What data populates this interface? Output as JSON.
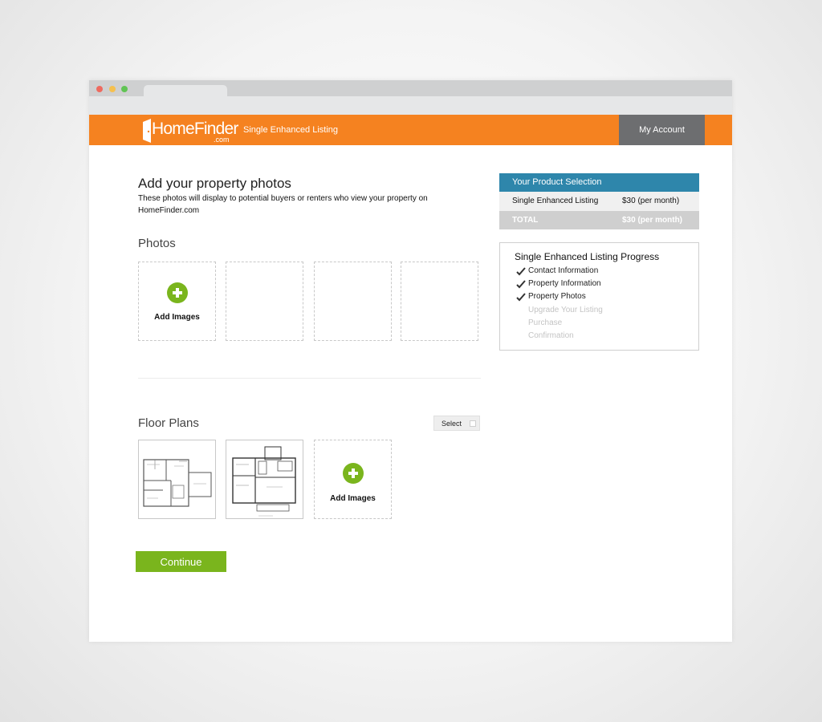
{
  "colors": {
    "brand_orange": "#f58220",
    "account_gray": "#6d6e70",
    "summary_blue": "#2e86ab",
    "accent_green": "#7ab51d",
    "dot_red": "#ee6a5f",
    "dot_yellow": "#f5c04f",
    "dot_green": "#61c454"
  },
  "header": {
    "logo_text": "HomeFinder",
    "logo_suffix": ".com",
    "subtitle": "Single Enhanced Listing",
    "account_label": "My Account",
    "logo_icon": "door-icon"
  },
  "main": {
    "title": "Add your property photos",
    "description": "These photos will display to potential buyers or renters who view your property on HomeFinder.com",
    "photos_heading": "Photos",
    "add_images_label": "Add Images",
    "floor_plans_heading": "Floor Plans",
    "select_label": "Select",
    "floor_plan_add_label": "Add Images",
    "continue_label": "Continue",
    "add_icon": "plus-circle-icon"
  },
  "summary": {
    "heading": "Your Product Selection",
    "item_name": "Single Enhanced Listing",
    "item_price": "$30 (per month)",
    "total_label": "TOTAL",
    "total_price": "$30 (per month)"
  },
  "progress": {
    "title": "Single Enhanced Listing Progress",
    "steps": [
      {
        "label": "Contact Information",
        "done": true
      },
      {
        "label": "Property Information",
        "done": true
      },
      {
        "label": "Property Photos",
        "done": true
      },
      {
        "label": "Upgrade Your Listing",
        "done": false
      },
      {
        "label": "Purchase",
        "done": false
      },
      {
        "label": "Confirmation",
        "done": false
      }
    ]
  }
}
